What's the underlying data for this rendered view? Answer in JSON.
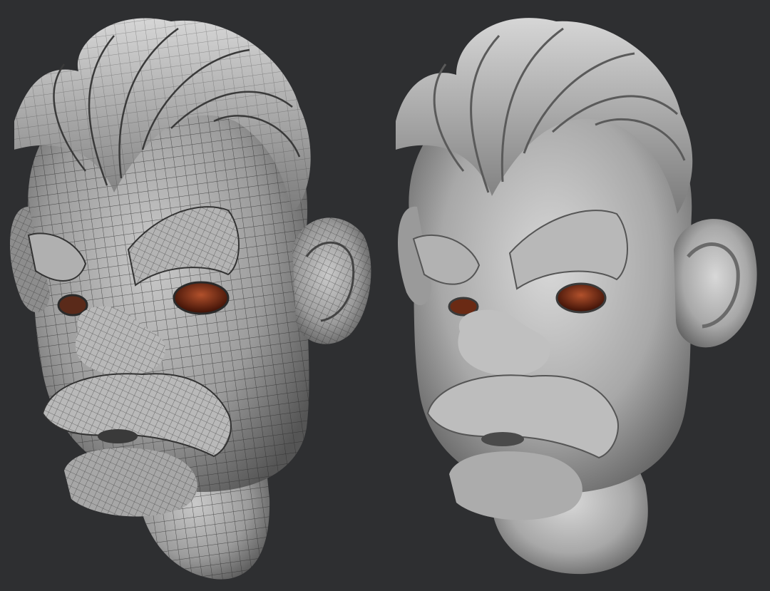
{
  "scene": {
    "background_color": "#2e2f31",
    "left_render": {
      "description_name": "wireframe-head-render",
      "base_color": "#9a9a9a",
      "wire_color": "#2a2a2a"
    },
    "right_render": {
      "description_name": "shaded-head-render",
      "base_color": "#a7a7a7"
    },
    "eye_color": "#7a2a14"
  }
}
